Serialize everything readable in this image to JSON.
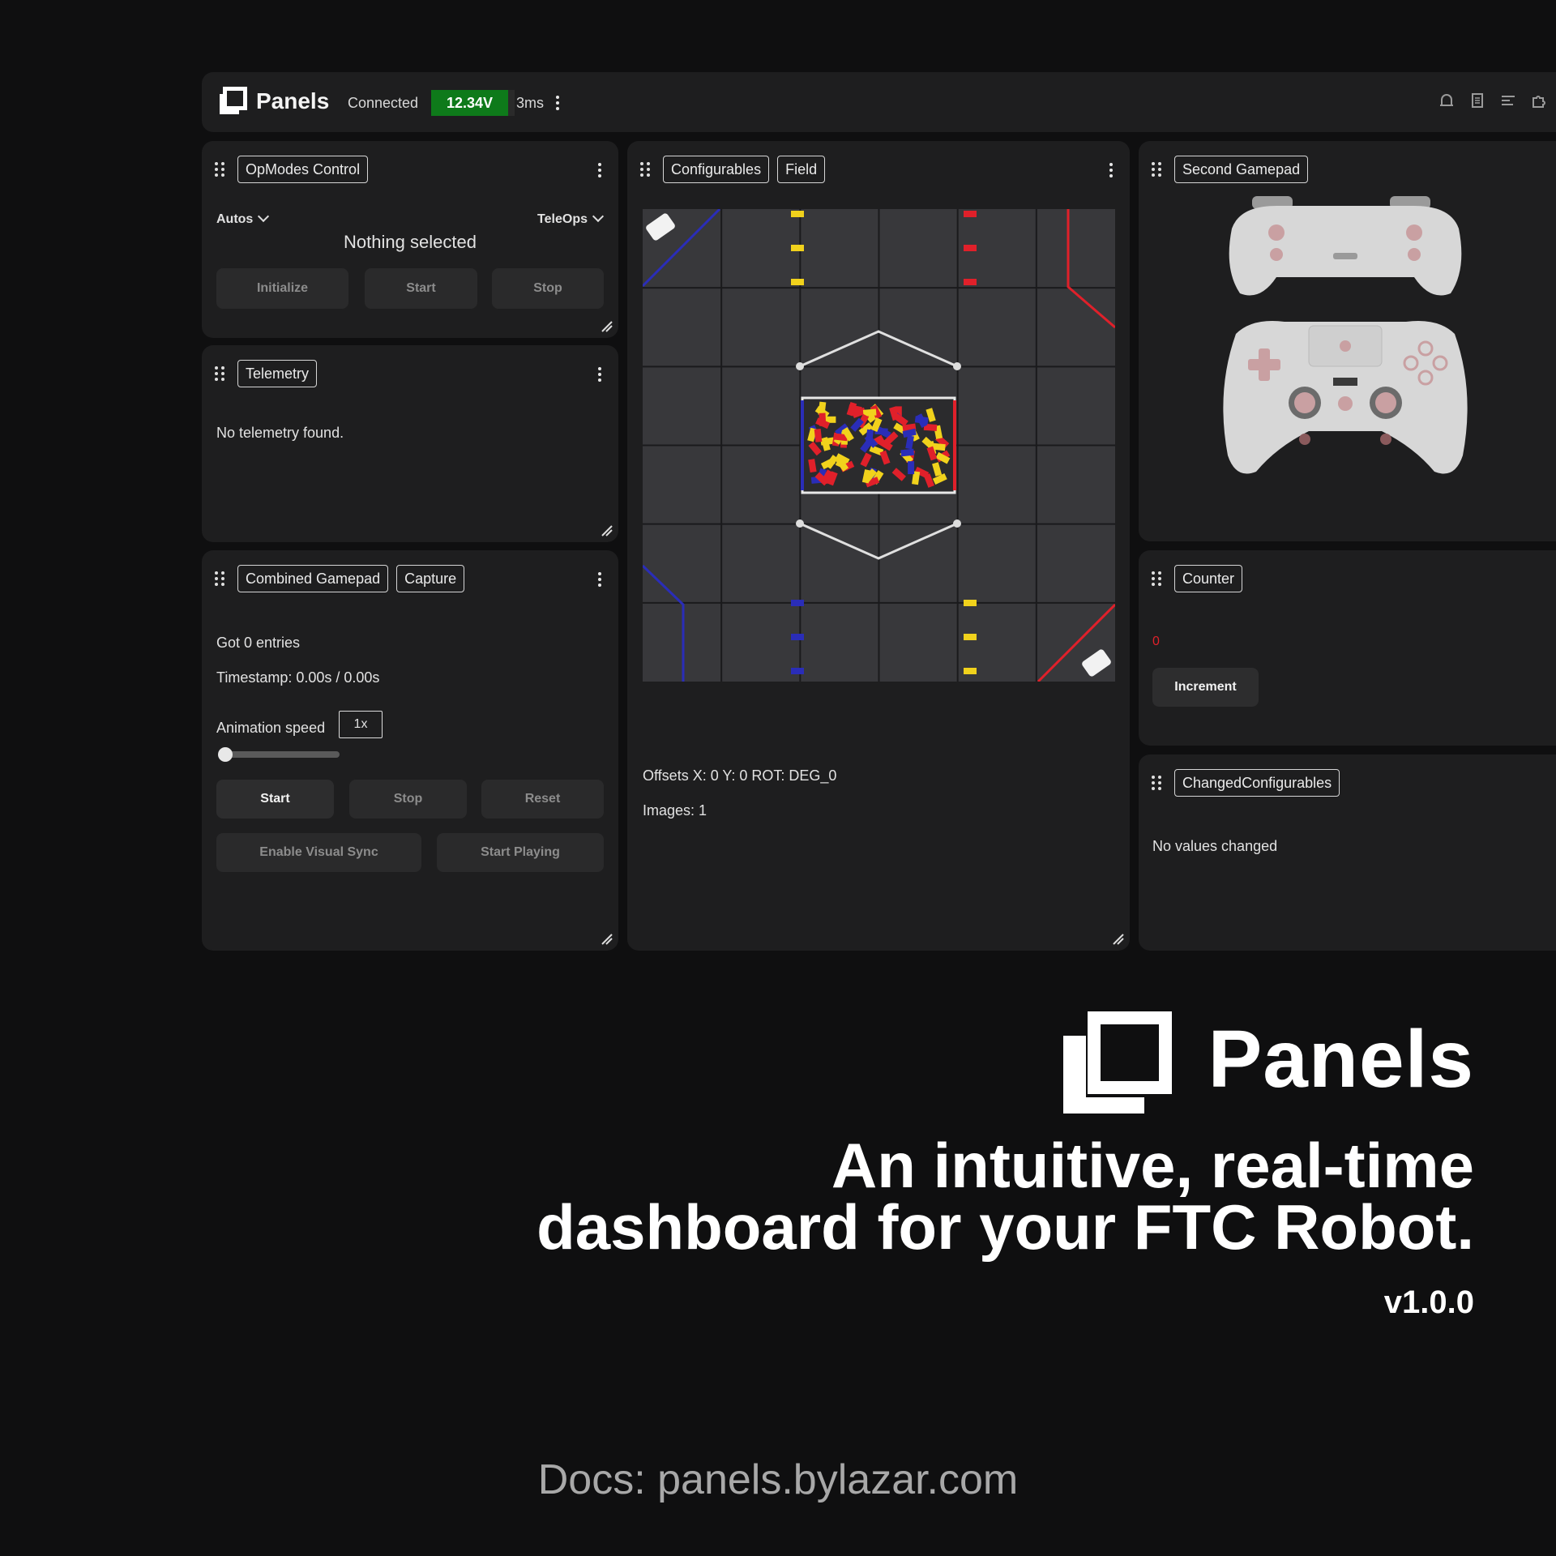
{
  "topbar": {
    "brand": "Panels",
    "status": "Connected",
    "voltage": "12.34V",
    "latency": "3ms",
    "icons": [
      "bell-icon",
      "document-icon",
      "list-icon",
      "puzzle-icon"
    ]
  },
  "opmodes": {
    "title": "OpModes Control",
    "autos": "Autos",
    "teleops": "TeleOps",
    "selection": "Nothing selected",
    "buttons": {
      "initialize": "Initialize",
      "start": "Start",
      "stop": "Stop"
    }
  },
  "telemetry": {
    "title": "Telemetry",
    "empty": "No telemetry found."
  },
  "combined_gamepad": {
    "title": "Combined Gamepad",
    "capture": "Capture",
    "entries": "Got 0 entries",
    "timestamp": "Timestamp: 0.00s / 0.00s",
    "animation_label": "Animation speed",
    "speed": "1x",
    "slider_fraction": 0.0,
    "buttons": {
      "start": "Start",
      "stop": "Stop",
      "reset": "Reset",
      "visual_sync": "Enable Visual Sync",
      "start_playing": "Start Playing"
    }
  },
  "field": {
    "tab_configurables": "Configurables",
    "tab_field": "Field",
    "offsets": "Offsets X: 0 Y: 0 ROT: DEG_0",
    "images": "Images: 1",
    "colors": {
      "blue": "#2a2db8",
      "red": "#e0202a",
      "yellow": "#f1d21c",
      "tile": "#38383b",
      "grid": "#1a1a1c"
    }
  },
  "second_gamepad": {
    "title": "Second Gamepad"
  },
  "counter": {
    "title": "Counter",
    "value": "0",
    "button": "Increment"
  },
  "changed": {
    "title": "ChangedConfigurables",
    "empty": "No values changed"
  },
  "hero": {
    "title": "Panels",
    "tagline_1": "An intuitive, real-time",
    "tagline_2": "dashboard for your FTC Robot.",
    "version": "v1.0.0",
    "docs": "Docs: panels.bylazar.com"
  }
}
